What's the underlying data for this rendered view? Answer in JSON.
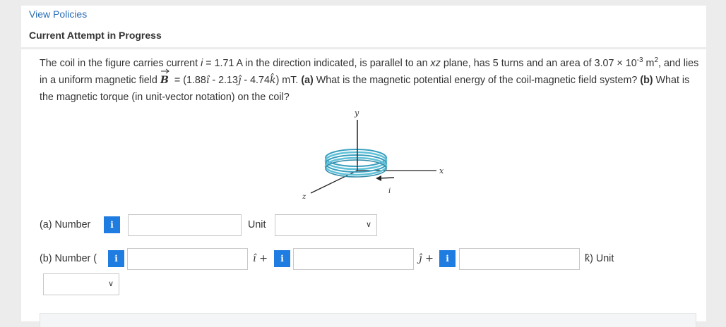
{
  "header": {
    "view_policies": "View Policies",
    "attempt_title": "Current Attempt in Progress"
  },
  "question": {
    "p1": "The coil in the figure carries current ",
    "i_var": "i",
    "p2": " = 1.71 A in the direction indicated, is parallel to an ",
    "xz": "xz",
    "p3": " plane, has 5 turns and an area of 3.07 × 10",
    "exp1": "-3",
    "m": "m",
    "exp2": "2",
    "p4": ", and lies in a uniform magnetic field ",
    "B": "B",
    "p5": " = (1.88",
    "ihat": "î",
    "p6": " - 2.13",
    "jhat": "ĵ",
    "p7": " - 4.74",
    "khat": "k̂",
    "p8": ") mT. ",
    "a_label": "(a)",
    "p9": " What is the magnetic potential energy of the coil-magnetic field system? ",
    "b_label": "(b)",
    "p10": " What is the magnetic torque (in unit-vector notation) on the coil?"
  },
  "figure": {
    "y": "y",
    "x": "x",
    "z": "z",
    "i": "i",
    "coil_color": "#5fc1d8"
  },
  "part_a": {
    "label": "(a) Number",
    "info": "i",
    "unit_label": "Unit",
    "value": "",
    "unit_value": ""
  },
  "part_b": {
    "label": "(b) Number (",
    "info": "i",
    "i_sep": "î +",
    "j_sep": "ĵ +",
    "k_unit": "k̂) Unit",
    "values": [
      "",
      "",
      ""
    ],
    "unit_value": ""
  },
  "colors": {
    "link": "#2a6db5",
    "info_button": "#1f7ce0",
    "background": "#ececec"
  }
}
